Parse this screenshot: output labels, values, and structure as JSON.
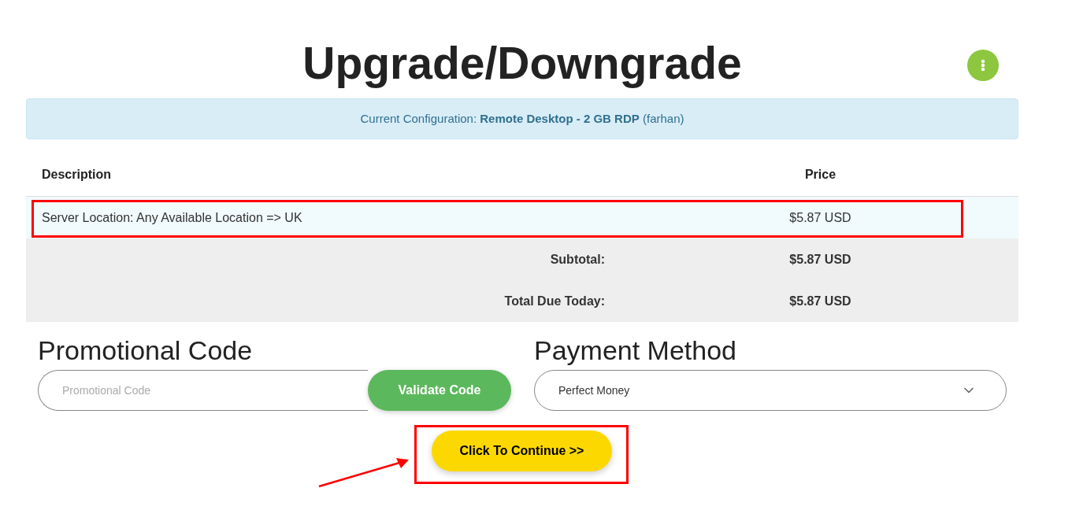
{
  "page": {
    "title": "Upgrade/Downgrade"
  },
  "current_configuration": {
    "text": "Current Configuration: **Remote Desktop - 2 GB RDP** (farhan)"
  },
  "table": {
    "columns": [
      "Description",
      "Price"
    ],
    "rows": [
      {
        "description": "Server Location: Any Available Location => UK",
        "price": "$5.87 USD",
        "highlighted": true
      }
    ]
  },
  "totals": [
    {
      "label": "Subtotal:",
      "value": "$5.87 USD"
    },
    {
      "label": "Total Due Today:",
      "value": "$5.87 USD"
    }
  ],
  "promotional_code": {
    "heading": "Promotional Code",
    "placeholder": "Promotional Code",
    "button": "Validate Code"
  },
  "payment_method": {
    "heading": "Payment Method",
    "value": "Perfect Money"
  },
  "continue_button": {
    "label": "Click To Continue >>",
    "highlighted": true
  }
}
